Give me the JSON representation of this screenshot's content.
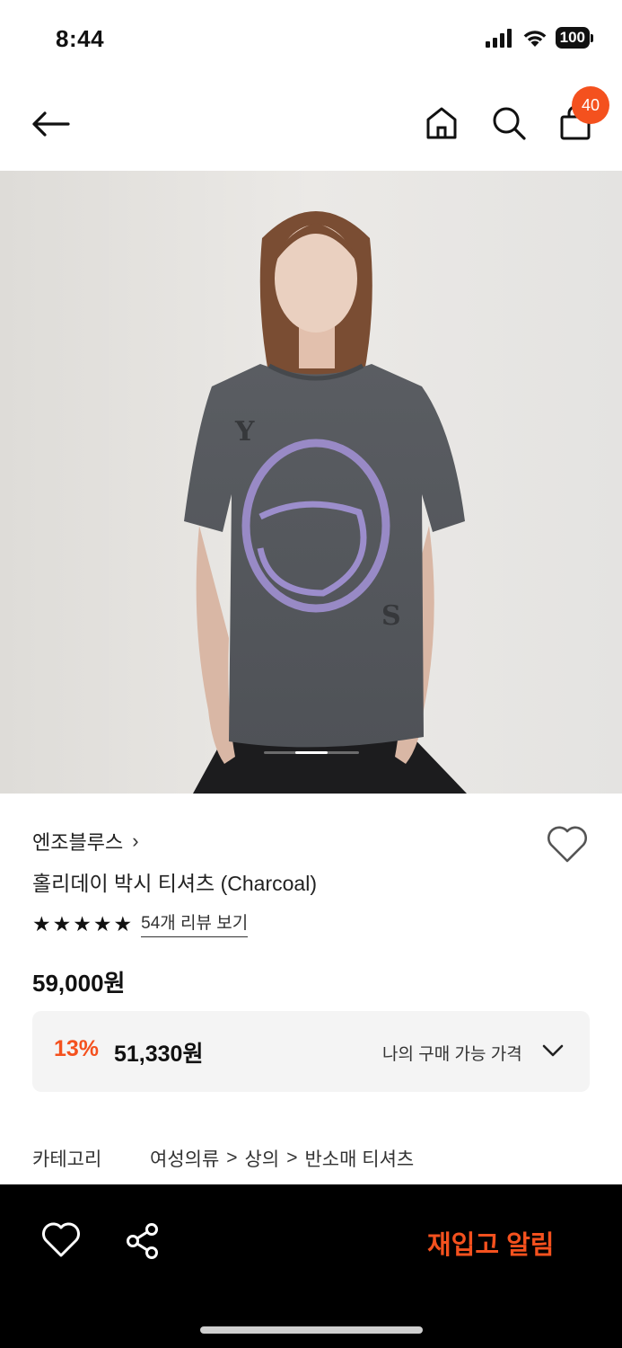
{
  "status_bar": {
    "time": "8:44",
    "battery": "100"
  },
  "nav": {
    "icons": [
      "back-arrow-icon",
      "home-icon",
      "search-icon",
      "shopping-bag-icon"
    ],
    "cart_badge": "40",
    "badge_color": "#f4511e"
  },
  "gallery": {
    "current_image": 2,
    "total_images": 3
  },
  "product": {
    "brand": "엔조블루스",
    "brand_chevron": "›",
    "name": "홀리데이 박시 티셔츠 (Charcoal)",
    "rating_stars": 5,
    "review_link": "54개 리뷰 보기",
    "price": "59,000원"
  },
  "discount": {
    "rate": "13%",
    "price": "51,330원",
    "label": "나의 구매 가능 가격"
  },
  "category": {
    "label": "카테고리",
    "path": [
      "여성의류",
      "상의",
      "반소매 티셔츠"
    ],
    "separator": ">"
  },
  "bottom_bar": {
    "restock_label": "재입고 알림",
    "accent_color": "#f4511e",
    "background": "#000000"
  }
}
